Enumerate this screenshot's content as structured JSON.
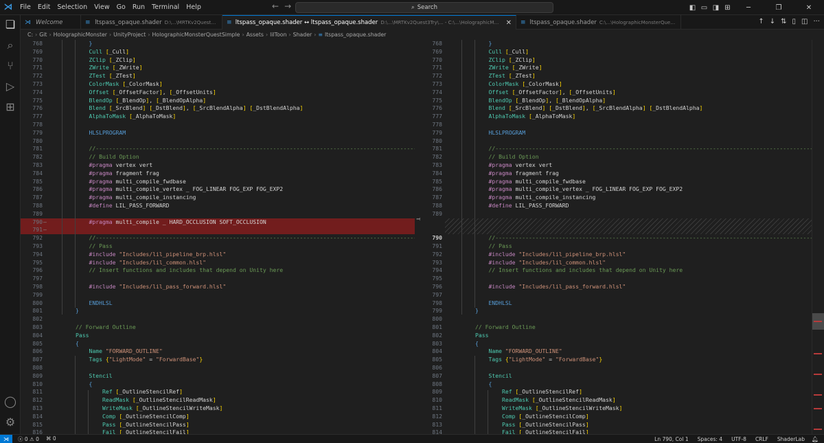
{
  "menu": [
    "File",
    "Edit",
    "Selection",
    "View",
    "Go",
    "Run",
    "Terminal",
    "Help"
  ],
  "search": {
    "label": "Search"
  },
  "tabs": [
    {
      "title": "Welcome",
      "desc": ""
    },
    {
      "title": "ltspass_opaque.shader",
      "desc": "D:\\...\\MRTKv2Quest3Try\\..."
    },
    {
      "title": "ltspass_opaque.shader ↔ ltspass_opaque.shader",
      "desc": "D:\\...\\MRTKv2Quest3Try\\... - C:\\...\\HolographicMonsterQuestSimple\\..."
    },
    {
      "title": "ltspass_opaque.shader",
      "desc": "C:\\...\\HolographicMonsterQuestSimple\\..."
    }
  ],
  "breadcrumb": [
    "C:",
    "Git",
    "HolographicMonster",
    "UnityProject",
    "HolographicMonsterQuestSimple",
    "Assets",
    "lilToon",
    "Shader",
    "ltspass_opaque.shader"
  ],
  "left_lines": [
    {
      "n": "768",
      "t": "            }"
    },
    {
      "n": "769",
      "t": "            Cull [_Cull]"
    },
    {
      "n": "770",
      "t": "            ZClip [_ZClip]"
    },
    {
      "n": "771",
      "t": "            ZWrite [_ZWrite]"
    },
    {
      "n": "772",
      "t": "            ZTest [_ZTest]"
    },
    {
      "n": "773",
      "t": "            ColorMask [_ColorMask]"
    },
    {
      "n": "774",
      "t": "            Offset [_OffsetFactor], [_OffsetUnits]"
    },
    {
      "n": "775",
      "t": "            BlendOp [_BlendOp], [_BlendOpAlpha]"
    },
    {
      "n": "776",
      "t": "            Blend [_SrcBlend] [_DstBlend], [_SrcBlendAlpha] [_DstBlendAlpha]"
    },
    {
      "n": "777",
      "t": "            AlphaToMask [_AlphaToMask]"
    },
    {
      "n": "778",
      "t": ""
    },
    {
      "n": "779",
      "t": "            HLSLPROGRAM"
    },
    {
      "n": "780",
      "t": ""
    },
    {
      "n": "781",
      "t": "            //----------------------------------------------------------------------------------------------------------------------"
    },
    {
      "n": "782",
      "t": "            // Build Option"
    },
    {
      "n": "783",
      "t": "            #pragma vertex vert"
    },
    {
      "n": "784",
      "t": "            #pragma fragment frag"
    },
    {
      "n": "785",
      "t": "            #pragma multi_compile_fwdbase"
    },
    {
      "n": "786",
      "t": "            #pragma multi_compile_vertex _ FOG_LINEAR FOG_EXP FOG_EXP2"
    },
    {
      "n": "787",
      "t": "            #pragma multi_compile_instancing"
    },
    {
      "n": "788",
      "t": "            #define LIL_PASS_FORWARD"
    },
    {
      "n": "789",
      "t": ""
    },
    {
      "n": "790",
      "t": "            #pragma multi_compile _ HARD_OCCLUSION SOFT_OCCLUSION"
    },
    {
      "n": "791",
      "t": ""
    },
    {
      "n": "792",
      "t": "            //----------------------------------------------------------------------------------------------------------------------"
    },
    {
      "n": "793",
      "t": "            // Pass"
    },
    {
      "n": "794",
      "t": "            #include \"Includes/lil_pipeline_brp.hlsl\""
    },
    {
      "n": "795",
      "t": "            #include \"Includes/lil_common.hlsl\""
    },
    {
      "n": "796",
      "t": "            // Insert functions and includes that depend on Unity here"
    },
    {
      "n": "797",
      "t": ""
    },
    {
      "n": "798",
      "t": "            #include \"Includes/lil_pass_forward.hlsl\""
    },
    {
      "n": "799",
      "t": ""
    },
    {
      "n": "800",
      "t": "            ENDHLSL"
    },
    {
      "n": "801",
      "t": "        }"
    },
    {
      "n": "802",
      "t": ""
    },
    {
      "n": "803",
      "t": "        // Forward Outline"
    },
    {
      "n": "804",
      "t": "        Pass"
    },
    {
      "n": "805",
      "t": "        {"
    },
    {
      "n": "806",
      "t": "            Name \"FORWARD_OUTLINE\""
    },
    {
      "n": "807",
      "t": "            Tags {\"LightMode\" = \"ForwardBase\"}"
    },
    {
      "n": "808",
      "t": ""
    },
    {
      "n": "809",
      "t": "            Stencil"
    },
    {
      "n": "810",
      "t": "            {"
    },
    {
      "n": "811",
      "t": "                Ref [_OutlineStencilRef]"
    },
    {
      "n": "812",
      "t": "                ReadMask [_OutlineStencilReadMask]"
    },
    {
      "n": "813",
      "t": "                WriteMask [_OutlineStencilWriteMask]"
    },
    {
      "n": "814",
      "t": "                Comp [_OutlineStencilComp]"
    },
    {
      "n": "815",
      "t": "                Pass [_OutlineStencilPass]"
    },
    {
      "n": "816",
      "t": "                Fail [_OutlineStencilFail]"
    }
  ],
  "right_lines": [
    {
      "n": "768",
      "t": "            }"
    },
    {
      "n": "769",
      "t": "            Cull [_Cull]"
    },
    {
      "n": "770",
      "t": "            ZClip [_ZClip]"
    },
    {
      "n": "771",
      "t": "            ZWrite [_ZWrite]"
    },
    {
      "n": "772",
      "t": "            ZTest [_ZTest]"
    },
    {
      "n": "773",
      "t": "            ColorMask [_ColorMask]"
    },
    {
      "n": "774",
      "t": "            Offset [_OffsetFactor], [_OffsetUnits]"
    },
    {
      "n": "775",
      "t": "            BlendOp [_BlendOp], [_BlendOpAlpha]"
    },
    {
      "n": "776",
      "t": "            Blend [_SrcBlend] [_DstBlend], [_SrcBlendAlpha] [_DstBlendAlpha]"
    },
    {
      "n": "777",
      "t": "            AlphaToMask [_AlphaToMask]"
    },
    {
      "n": "778",
      "t": ""
    },
    {
      "n": "779",
      "t": "            HLSLPROGRAM"
    },
    {
      "n": "780",
      "t": ""
    },
    {
      "n": "781",
      "t": "            //----------------------------------------------------------------------------------------------------------------------"
    },
    {
      "n": "782",
      "t": "            // Build Option"
    },
    {
      "n": "783",
      "t": "            #pragma vertex vert"
    },
    {
      "n": "784",
      "t": "            #pragma fragment frag"
    },
    {
      "n": "785",
      "t": "            #pragma multi_compile_fwdbase"
    },
    {
      "n": "786",
      "t": "            #pragma multi_compile_vertex _ FOG_LINEAR FOG_EXP FOG_EXP2"
    },
    {
      "n": "787",
      "t": "            #pragma multi_compile_instancing"
    },
    {
      "n": "788",
      "t": "            #define LIL_PASS_FORWARD"
    },
    {
      "n": "789",
      "t": ""
    },
    {
      "n": "",
      "t": ""
    },
    {
      "n": "",
      "t": ""
    },
    {
      "n": "790",
      "t": "            //----------------------------------------------------------------------------------------------------------------------"
    },
    {
      "n": "791",
      "t": "            // Pass"
    },
    {
      "n": "792",
      "t": "            #include \"Includes/lil_pipeline_brp.hlsl\""
    },
    {
      "n": "793",
      "t": "            #include \"Includes/lil_common.hlsl\""
    },
    {
      "n": "794",
      "t": "            // Insert functions and includes that depend on Unity here"
    },
    {
      "n": "795",
      "t": ""
    },
    {
      "n": "796",
      "t": "            #include \"Includes/lil_pass_forward.hlsl\""
    },
    {
      "n": "797",
      "t": ""
    },
    {
      "n": "798",
      "t": "            ENDHLSL"
    },
    {
      "n": "799",
      "t": "        }"
    },
    {
      "n": "800",
      "t": ""
    },
    {
      "n": "801",
      "t": "        // Forward Outline"
    },
    {
      "n": "802",
      "t": "        Pass"
    },
    {
      "n": "803",
      "t": "        {"
    },
    {
      "n": "804",
      "t": "            Name \"FORWARD_OUTLINE\""
    },
    {
      "n": "805",
      "t": "            Tags {\"LightMode\" = \"ForwardBase\"}"
    },
    {
      "n": "806",
      "t": ""
    },
    {
      "n": "807",
      "t": "            Stencil"
    },
    {
      "n": "808",
      "t": "            {"
    },
    {
      "n": "809",
      "t": "                Ref [_OutlineStencilRef]"
    },
    {
      "n": "810",
      "t": "                ReadMask [_OutlineStencilReadMask]"
    },
    {
      "n": "811",
      "t": "                WriteMask [_OutlineStencilWriteMask]"
    },
    {
      "n": "812",
      "t": "                Comp [_OutlineStencilComp]"
    },
    {
      "n": "813",
      "t": "                Pass [_OutlineStencilPass]"
    },
    {
      "n": "814",
      "t": "                Fail [_OutlineStencilFail]"
    }
  ],
  "status": {
    "errors": "0",
    "warnings": "0",
    "ports": "0",
    "cursor": "Ln 790, Col 1",
    "spaces": "Spaces: 4",
    "encoding": "UTF-8",
    "eol": "CRLF",
    "language": "ShaderLab"
  },
  "colors": {
    "accent": "#0078d4",
    "removed": "#721d1d",
    "background": "#1f1f1f"
  },
  "icons": [
    "vscode-logo-icon",
    "files-icon",
    "search-icon",
    "source-control-icon",
    "run-debug-icon",
    "extensions-icon",
    "account-icon",
    "settings-gear-icon"
  ]
}
